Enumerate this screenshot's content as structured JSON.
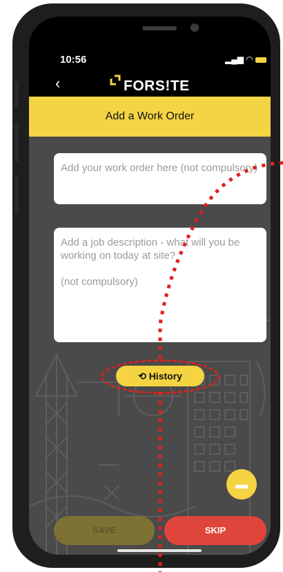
{
  "status": {
    "time": "10:56"
  },
  "app": {
    "back_icon": "‹",
    "logo_text": "FORS!TE"
  },
  "header": {
    "title": "Add a Work Order"
  },
  "form": {
    "work_order_placeholder": "Add your work order here (not compulsory)",
    "job_description_line1": "Add a job description - what will you be working on today at site?",
    "job_description_line2": "(not compulsory)"
  },
  "history": {
    "label": "History",
    "icon": "history-clock-icon"
  },
  "chat": {
    "icon": "chat-icon"
  },
  "footer": {
    "save_label": "SAVE",
    "skip_label": "SKIP"
  },
  "colors": {
    "accent": "#F4D443",
    "skip": "#E0453B",
    "background": "#4A4A4A"
  }
}
